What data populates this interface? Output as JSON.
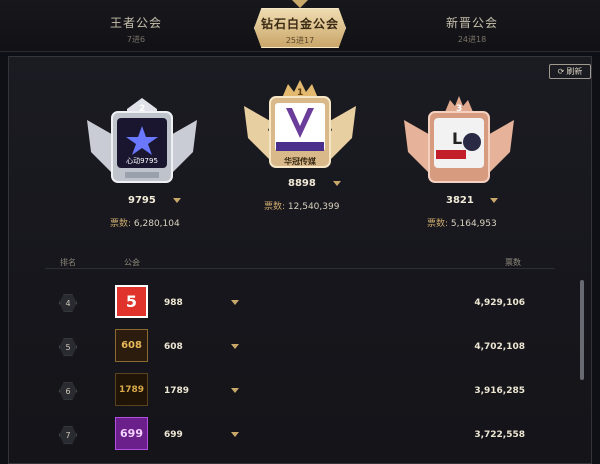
{
  "tabs": [
    {
      "title": "王者公会",
      "sub": "7进6"
    },
    {
      "title": "钻石白金公会",
      "sub": "25进17"
    },
    {
      "title": "新晋公会",
      "sub": "24进18"
    }
  ],
  "refresh_label": "刷新",
  "votes_label": "票数:",
  "podium": [
    {
      "rank": "2",
      "count": "9795",
      "votes": "6,280,104",
      "logo_text": "心动9795"
    },
    {
      "rank": "1",
      "count": "8898",
      "votes": "12,540,399",
      "logo_text": "华冠传媒"
    },
    {
      "rank": "3",
      "count": "3821",
      "votes": "5,164,953",
      "logo_text": "L+"
    }
  ],
  "table": {
    "headers": [
      "排名",
      "公会",
      "票数"
    ],
    "rows": [
      {
        "rank": "4",
        "count": "988",
        "votes": "4,929,106",
        "logo_text": "5",
        "logo_color": "#e0332b"
      },
      {
        "rank": "5",
        "count": "608",
        "votes": "4,702,108",
        "logo_text": "608",
        "logo_color": "#2b1c0d"
      },
      {
        "rank": "6",
        "count": "1789",
        "votes": "3,916,285",
        "logo_text": "1789",
        "logo_color": "#1f1406"
      },
      {
        "rank": "7",
        "count": "699",
        "votes": "3,722,558",
        "logo_text": "699",
        "logo_color": "#6a1f8a"
      }
    ]
  }
}
